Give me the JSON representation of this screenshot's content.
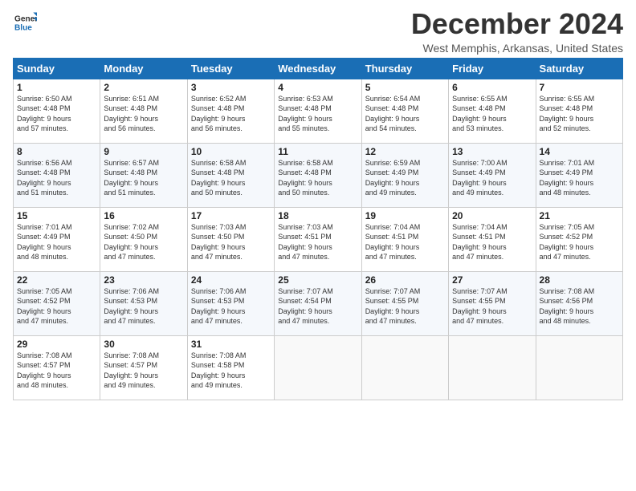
{
  "header": {
    "logo_line1": "General",
    "logo_line2": "Blue",
    "title": "December 2024",
    "location": "West Memphis, Arkansas, United States"
  },
  "days_of_week": [
    "Sunday",
    "Monday",
    "Tuesday",
    "Wednesday",
    "Thursday",
    "Friday",
    "Saturday"
  ],
  "weeks": [
    [
      {
        "day": "1",
        "info": "Sunrise: 6:50 AM\nSunset: 4:48 PM\nDaylight: 9 hours\nand 57 minutes."
      },
      {
        "day": "2",
        "info": "Sunrise: 6:51 AM\nSunset: 4:48 PM\nDaylight: 9 hours\nand 56 minutes."
      },
      {
        "day": "3",
        "info": "Sunrise: 6:52 AM\nSunset: 4:48 PM\nDaylight: 9 hours\nand 56 minutes."
      },
      {
        "day": "4",
        "info": "Sunrise: 6:53 AM\nSunset: 4:48 PM\nDaylight: 9 hours\nand 55 minutes."
      },
      {
        "day": "5",
        "info": "Sunrise: 6:54 AM\nSunset: 4:48 PM\nDaylight: 9 hours\nand 54 minutes."
      },
      {
        "day": "6",
        "info": "Sunrise: 6:55 AM\nSunset: 4:48 PM\nDaylight: 9 hours\nand 53 minutes."
      },
      {
        "day": "7",
        "info": "Sunrise: 6:55 AM\nSunset: 4:48 PM\nDaylight: 9 hours\nand 52 minutes."
      }
    ],
    [
      {
        "day": "8",
        "info": "Sunrise: 6:56 AM\nSunset: 4:48 PM\nDaylight: 9 hours\nand 51 minutes."
      },
      {
        "day": "9",
        "info": "Sunrise: 6:57 AM\nSunset: 4:48 PM\nDaylight: 9 hours\nand 51 minutes."
      },
      {
        "day": "10",
        "info": "Sunrise: 6:58 AM\nSunset: 4:48 PM\nDaylight: 9 hours\nand 50 minutes."
      },
      {
        "day": "11",
        "info": "Sunrise: 6:58 AM\nSunset: 4:48 PM\nDaylight: 9 hours\nand 50 minutes."
      },
      {
        "day": "12",
        "info": "Sunrise: 6:59 AM\nSunset: 4:49 PM\nDaylight: 9 hours\nand 49 minutes."
      },
      {
        "day": "13",
        "info": "Sunrise: 7:00 AM\nSunset: 4:49 PM\nDaylight: 9 hours\nand 49 minutes."
      },
      {
        "day": "14",
        "info": "Sunrise: 7:01 AM\nSunset: 4:49 PM\nDaylight: 9 hours\nand 48 minutes."
      }
    ],
    [
      {
        "day": "15",
        "info": "Sunrise: 7:01 AM\nSunset: 4:49 PM\nDaylight: 9 hours\nand 48 minutes."
      },
      {
        "day": "16",
        "info": "Sunrise: 7:02 AM\nSunset: 4:50 PM\nDaylight: 9 hours\nand 47 minutes."
      },
      {
        "day": "17",
        "info": "Sunrise: 7:03 AM\nSunset: 4:50 PM\nDaylight: 9 hours\nand 47 minutes."
      },
      {
        "day": "18",
        "info": "Sunrise: 7:03 AM\nSunset: 4:51 PM\nDaylight: 9 hours\nand 47 minutes."
      },
      {
        "day": "19",
        "info": "Sunrise: 7:04 AM\nSunset: 4:51 PM\nDaylight: 9 hours\nand 47 minutes."
      },
      {
        "day": "20",
        "info": "Sunrise: 7:04 AM\nSunset: 4:51 PM\nDaylight: 9 hours\nand 47 minutes."
      },
      {
        "day": "21",
        "info": "Sunrise: 7:05 AM\nSunset: 4:52 PM\nDaylight: 9 hours\nand 47 minutes."
      }
    ],
    [
      {
        "day": "22",
        "info": "Sunrise: 7:05 AM\nSunset: 4:52 PM\nDaylight: 9 hours\nand 47 minutes."
      },
      {
        "day": "23",
        "info": "Sunrise: 7:06 AM\nSunset: 4:53 PM\nDaylight: 9 hours\nand 47 minutes."
      },
      {
        "day": "24",
        "info": "Sunrise: 7:06 AM\nSunset: 4:53 PM\nDaylight: 9 hours\nand 47 minutes."
      },
      {
        "day": "25",
        "info": "Sunrise: 7:07 AM\nSunset: 4:54 PM\nDaylight: 9 hours\nand 47 minutes."
      },
      {
        "day": "26",
        "info": "Sunrise: 7:07 AM\nSunset: 4:55 PM\nDaylight: 9 hours\nand 47 minutes."
      },
      {
        "day": "27",
        "info": "Sunrise: 7:07 AM\nSunset: 4:55 PM\nDaylight: 9 hours\nand 47 minutes."
      },
      {
        "day": "28",
        "info": "Sunrise: 7:08 AM\nSunset: 4:56 PM\nDaylight: 9 hours\nand 48 minutes."
      }
    ],
    [
      {
        "day": "29",
        "info": "Sunrise: 7:08 AM\nSunset: 4:57 PM\nDaylight: 9 hours\nand 48 minutes."
      },
      {
        "day": "30",
        "info": "Sunrise: 7:08 AM\nSunset: 4:57 PM\nDaylight: 9 hours\nand 49 minutes."
      },
      {
        "day": "31",
        "info": "Sunrise: 7:08 AM\nSunset: 4:58 PM\nDaylight: 9 hours\nand 49 minutes."
      },
      null,
      null,
      null,
      null
    ]
  ]
}
